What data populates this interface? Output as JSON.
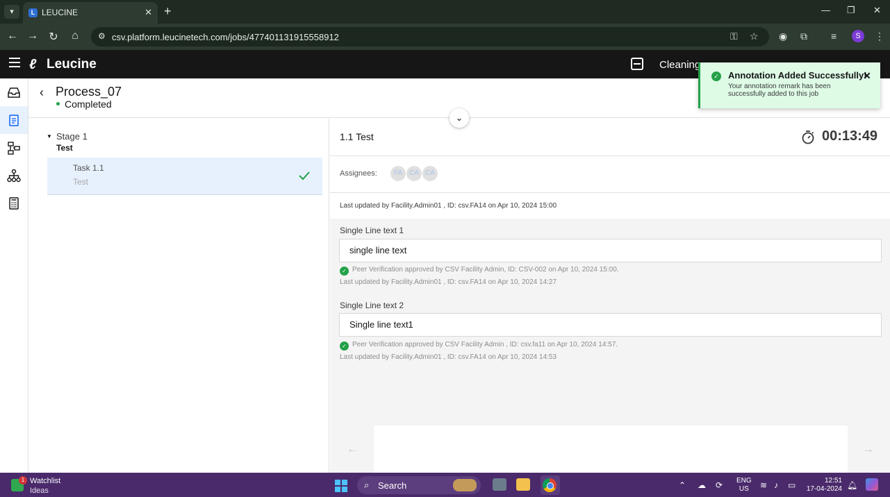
{
  "browser": {
    "tab_title": "LEUCINE",
    "url": "csv.platform.leucinetech.com/jobs/477401131915558912",
    "profile_initial": "S"
  },
  "app": {
    "logo_text": "Leucine",
    "facility": "Cleaning"
  },
  "job": {
    "title": "Process_07",
    "status": "Completed",
    "status_color": "#24a148"
  },
  "stage": {
    "name": "Stage 1",
    "subtitle": "Test",
    "task": {
      "name": "Task 1.1",
      "subtitle": "Test"
    }
  },
  "task_detail": {
    "title": "1.1 Test",
    "timer": "00:13:49",
    "assignees_label": "Assignees:",
    "assignees": [
      "FA",
      "CA",
      "CA"
    ],
    "last_updated": "Last updated by Facility.Admin01 , ID: csv.FA14 on Apr 10, 2024 15:00",
    "parameters": [
      {
        "label": "Single Line text 1",
        "value": "single line text",
        "verification": "Peer Verification approved by CSV Facility Admin, ID: CSV-002 on Apr 10, 2024 15:00.",
        "updated": "Last updated by Facility.Admin01 , ID: csv.FA14 on Apr 10, 2024 14:27"
      },
      {
        "label": "Single Line text 2",
        "value": "Single line text1",
        "verification": "Peer Verification approved by CSV Facility Admin , ID: csv.fa11 on Apr 10, 2024 14:57.",
        "updated": "Last updated by Facility.Admin01 , ID: csv.FA14 on Apr 10, 2024 14:53"
      }
    ]
  },
  "toast": {
    "title": "Annotation Added Successfully!",
    "message": "Your annotation remark has been successfully added to this job",
    "color": "#24a148"
  },
  "taskbar": {
    "watchlist_title": "Watchlist",
    "watchlist_sub": "Ideas",
    "watchlist_badge": "1",
    "search_label": "Search",
    "lang_1": "ENG",
    "lang_2": "US",
    "time": "12:51",
    "date": "17-04-2024"
  }
}
